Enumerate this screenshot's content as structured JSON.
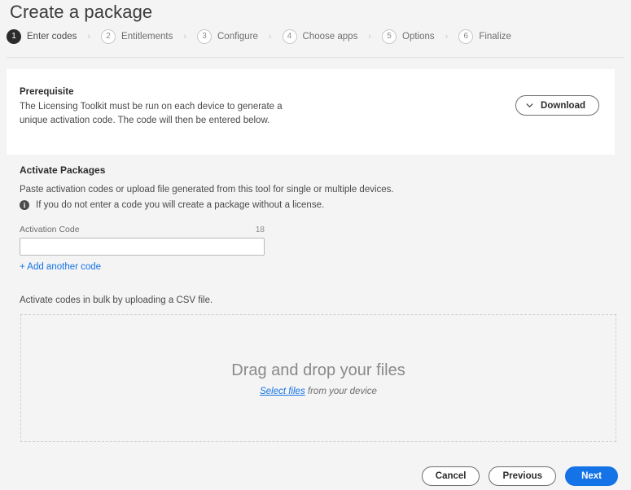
{
  "page": {
    "title": "Create a package"
  },
  "stepper": {
    "separator": "›",
    "steps": [
      {
        "number": "1",
        "label": "Enter codes",
        "active": true
      },
      {
        "number": "2",
        "label": "Entitlements",
        "active": false
      },
      {
        "number": "3",
        "label": "Configure",
        "active": false
      },
      {
        "number": "4",
        "label": "Choose apps",
        "active": false
      },
      {
        "number": "5",
        "label": "Options",
        "active": false
      },
      {
        "number": "6",
        "label": "Finalize",
        "active": false
      }
    ]
  },
  "prerequisite": {
    "title": "Prerequisite",
    "body": "The Licensing Toolkit must be run on each device to generate a unique activation code. The code will then be entered below.",
    "download_label": "Download",
    "download_icon": "chevron-down-icon"
  },
  "activate": {
    "title": "Activate Packages",
    "subtitle": "Paste activation codes or upload file generated from this tool for single or multiple devices.",
    "info_icon": "info-icon",
    "info_glyph": "i",
    "info_text": "If you do not enter a code you will create a package without a license.",
    "field_label": "Activation Code",
    "field_count": "18",
    "field_value": "",
    "field_placeholder": "",
    "add_another_label": "+ Add another code"
  },
  "bulk": {
    "label": "Activate codes in bulk by uploading a CSV file.",
    "dropzone_title": "Drag and drop your files",
    "dropzone_link": "Select files",
    "dropzone_tail": " from your device"
  },
  "footer": {
    "cancel_label": "Cancel",
    "previous_label": "Previous",
    "next_label": "Next"
  },
  "colors": {
    "accent": "#1473e6",
    "page_background": "#f4f4f4",
    "card_background": "#ffffff",
    "active_step": "#2c2c2c"
  }
}
